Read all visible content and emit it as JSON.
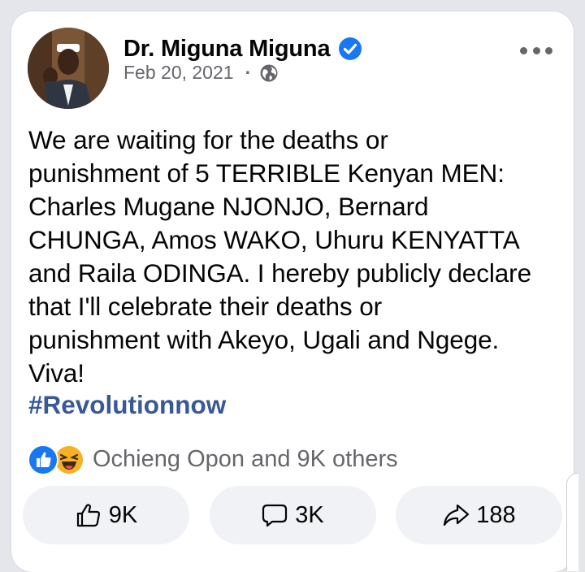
{
  "post": {
    "author_name": "Dr. Miguna Miguna",
    "date": "Feb 20, 2021",
    "separator": "·",
    "privacy_icon": "globe-icon",
    "verified_icon": "verified-badge-icon",
    "more_icon": "more-options-icon",
    "text_lines": [
      "We are waiting for the deaths or",
      "punishment of 5 TERRIBLE Kenyan MEN:",
      "Charles Mugane NJONJO, Bernard",
      "CHUNGA, Amos WAKO, Uhuru KENYATTA",
      "and Raila ODINGA. I hereby publicly declare",
      "that I'll celebrate their deaths or",
      "punishment with Akeyo, Ugali and Ngege.",
      "Viva!"
    ],
    "hashtag": "#Revolutionnow"
  },
  "reactions": {
    "icons": [
      "like-reaction-icon",
      "haha-reaction-icon"
    ],
    "summary": "Ochieng Opon and 9K others"
  },
  "actions": {
    "like": {
      "icon": "thumbs-up-icon",
      "count": "9K"
    },
    "comment": {
      "icon": "comment-icon",
      "count": "3K"
    },
    "share": {
      "icon": "share-arrow-icon",
      "count": "188"
    }
  },
  "colors": {
    "brand_blue": "#1877f2",
    "hashtag_blue": "#385898",
    "secondary_text": "#65676b",
    "haha_yellow": "#f7b125"
  }
}
